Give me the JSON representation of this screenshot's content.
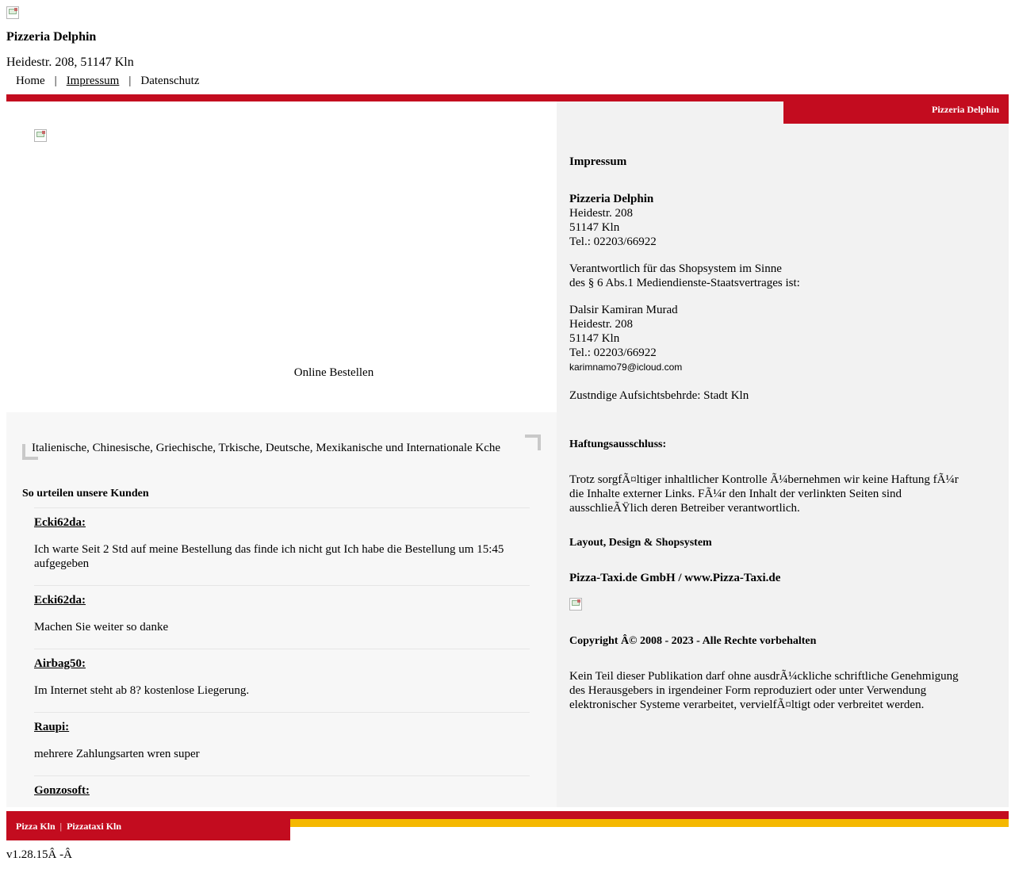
{
  "header": {
    "name": "Pizzeria Delphin",
    "address": "Heidestr. 208, 51147 Kln"
  },
  "nav": {
    "items": [
      "Home",
      "Impressum",
      "Datenschutz"
    ],
    "separator": "|",
    "active": "Impressum"
  },
  "main": {
    "online_order": "Online Bestellen",
    "cuisines": "Italienische, Chinesische, Griechische, Trkische, Deutsche, Mexikanische und Internationale Kche",
    "reviews_title": "So urteilen unsere Kunden",
    "reviews": [
      {
        "author": "Ecki62da:",
        "text": "Ich warte Seit 2 Std auf meine Bestellung das finde ich nicht gut Ich habe die Bestellung um 15:45 aufgegeben"
      },
      {
        "author": "Ecki62da:",
        "text": "Machen Sie weiter so danke"
      },
      {
        "author": "Airbag50:",
        "text": "Im Internet steht ab 8? kostenlose Liegerung."
      },
      {
        "author": "Raupi:",
        "text": "mehrere Zahlungsarten wren super"
      },
      {
        "author": "Gonzosoft:",
        "text": ""
      }
    ]
  },
  "impressum": {
    "tab_label": "Pizzeria Delphin",
    "title": "Impressum",
    "company": "Pizzeria Delphin",
    "street": "Heidestr. 208",
    "city": "51147 Kln",
    "phone": "Tel.: 02203/66922",
    "responsible_line1": "Verantwortlich für das Shopsystem im Sinne",
    "responsible_line2": "des § 6 Abs.1 Mediendienste-Staatsvertrages ist:",
    "person": "Dalsir Kamiran Murad",
    "person_street": "Heidestr. 208",
    "person_city": "51147 Kln",
    "person_phone": "Tel.: 02203/66922",
    "email": "karimnamo79@icloud.com",
    "authority": "Zustndige Aufsichtsbehrde: Stadt Kln",
    "disclaimer_title": "Haftungsausschluss:",
    "disclaimer_line1": "Trotz sorgfÃ¤ltiger inhaltlicher Kontrolle Ã¼bernehmen wir keine Haftung fÃ¼r",
    "disclaimer_line2": "die Inhalte externer Links. FÃ¼r den Inhalt der verlinkten Seiten sind",
    "disclaimer_line3": "ausschlieÃŸlich deren Betreiber verantwortlich.",
    "layout_title": "Layout, Design & Shopsystem",
    "provider": "Pizza-Taxi.de GmbH / www.Pizza-Taxi.de",
    "copyright": "Copyright Â© 2008 - 2023 - Alle Rechte vorbehalten",
    "rights_line1": "Kein Teil dieser Publikation darf ohne ausdrÃ¼ckliche schriftliche Genehmigung",
    "rights_line2": "des Herausgebers in irgendeiner Form reproduziert oder unter Verwendung",
    "rights_line3": "elektronischer Systeme verarbeitet, vervielfÃ¤ltigt oder verbreitet werden."
  },
  "footer": {
    "link1": "Pizza Kln",
    "separator": "|",
    "link2": "Pizzataxi Kln",
    "version": "v1.28.15Â -Â"
  },
  "colors": {
    "brand_red": "#c30c1f",
    "brand_yellow": "#f5b800",
    "panel_gray": "#f2f2f2"
  }
}
